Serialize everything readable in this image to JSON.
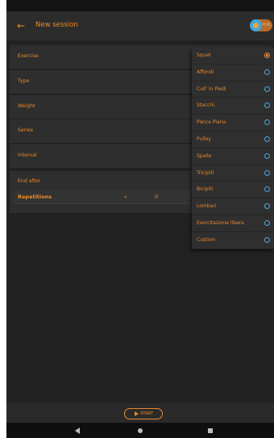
{
  "appbar": {
    "title": "New session",
    "avatar_text": "H.R."
  },
  "form": {
    "rows": [
      {
        "label": "Exercise"
      },
      {
        "label": "Type"
      },
      {
        "label": "Weight"
      },
      {
        "label": "Series"
      },
      {
        "label": "Interval"
      }
    ],
    "end_after": {
      "label": "End after",
      "mode": "Repetitions",
      "decrement": "–",
      "value": "0"
    }
  },
  "exercise_dropdown": {
    "selected": "Squat",
    "options": [
      "Squat",
      "Affondi",
      "Cull' in Piedi",
      "Stacchi",
      "Panca Piana",
      "Pulley",
      "Spalle",
      "Tricipiti",
      "Bicipiti",
      "Lombari",
      "Esercitazione libera",
      "Custom"
    ]
  },
  "actions": {
    "start_label": "START"
  },
  "icons": {
    "back": "arrow-left-icon",
    "play": "play-icon",
    "nav_back": "triangle-back-icon",
    "nav_home": "circle-home-icon",
    "nav_recent": "square-recent-icon"
  },
  "colors": {
    "accent": "#e98a2c",
    "radio_unselected": "#4aa8df",
    "background": "#222222"
  }
}
